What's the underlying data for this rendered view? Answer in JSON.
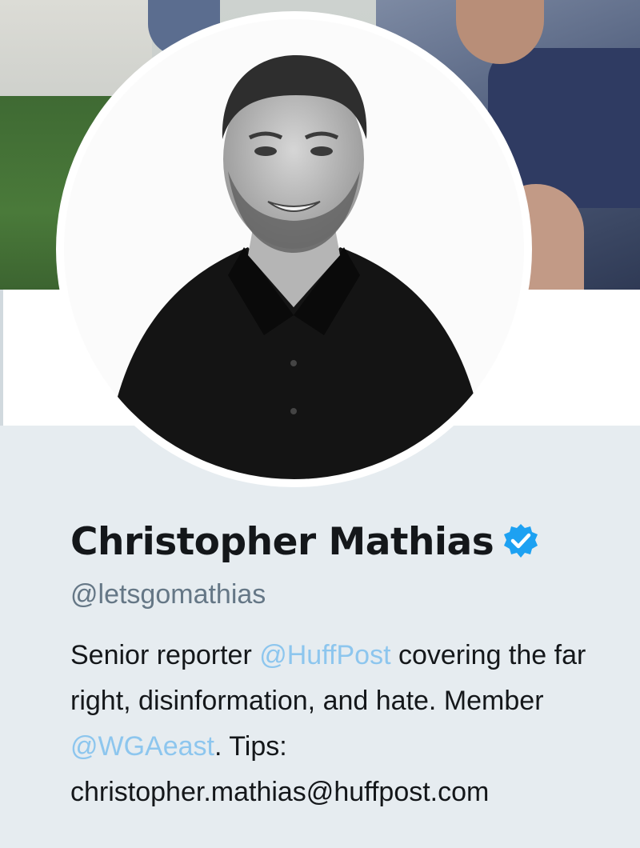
{
  "profile": {
    "name": "Christopher Mathias",
    "handle": "@letsgomathias",
    "verified": true,
    "bio": {
      "part1": "Senior reporter ",
      "mention1": "@HuffPost",
      "part2": " covering the far right, disinformation, and hate. Member ",
      "mention2": "@WGAeast",
      "part3": ". Tips: christopher.mathias@huffpost.com"
    }
  },
  "icons": {
    "verified": "verified-badge-icon"
  },
  "colors": {
    "page_background": "#e6ecf0",
    "link": "#8dc6ee",
    "verified_badge": "#1da1f2",
    "name_text": "#14171a",
    "handle_text": "#657786"
  }
}
